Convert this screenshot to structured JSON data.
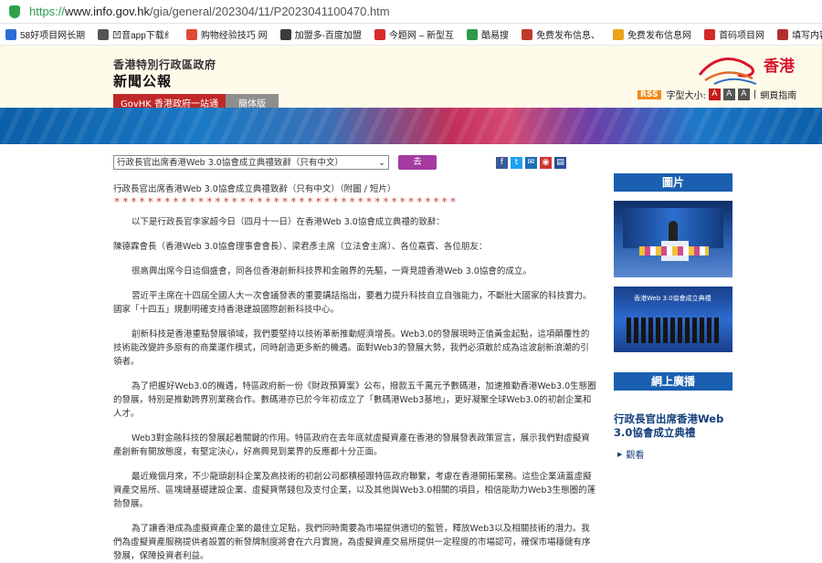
{
  "browser": {
    "url_https": "https://",
    "url_host": "www.info.gov.hk",
    "url_path": "/gia/general/202304/11/P2023041100470.htm",
    "bookmarks": [
      {
        "label": "58好项目网长期",
        "color": "#2d6dd6"
      },
      {
        "label": "凹音app下载纟",
        "color": "#555555"
      },
      {
        "label": "购物经验技巧 网",
        "color": "#e0493a"
      },
      {
        "label": "加盟多-百度加盟",
        "color": "#3b3b3b"
      },
      {
        "label": "今题网 – 新型互",
        "color": "#d82a2a"
      },
      {
        "label": "酷易搜",
        "color": "#2c9a4c"
      },
      {
        "label": "免费发布信息、",
        "color": "#c0392b"
      },
      {
        "label": "免费发布信息网",
        "color": "#e8a319"
      },
      {
        "label": "首码项目网",
        "color": "#d02a2a"
      },
      {
        "label": "填写内容-登录",
        "color": "#b03030"
      }
    ]
  },
  "header": {
    "govt_name": "香港特別行政區政府",
    "site_title": "新聞公報",
    "logo_text": "香港",
    "rss": "RSS",
    "font_size_label": "字型大小:",
    "font_sizes": [
      "A",
      "A",
      "A"
    ],
    "guide": "網頁指南",
    "nav_govhk": "GovHK 香港政府一站通",
    "nav_simplified": "簡体版"
  },
  "article": {
    "select_value": "行政長官出席香港Web 3.0協會成立典禮致辭（只有中文）",
    "go_button": "去",
    "headline": "行政長官出席香港Web 3.0協會成立典禮致辭（只有中文）（附圖 / 短片）",
    "stars": "＊＊＊＊＊＊＊＊＊＊＊＊＊＊＊＊＊＊＊＊＊＊＊＊＊＊＊＊＊＊＊＊＊＊＊＊＊＊＊＊＊",
    "paragraphs": [
      "以下是行政長官李家超今日（四月十一日）在香港Web 3.0協會成立典禮的致辭：",
      "陳德霖會長（香港Web 3.0協會理事會會長）、梁君彥主席（立法會主席）、各位嘉賓、各位朋友：",
      "很高興出席今日這個盛會，同各位香港創新科技界和金融界的先驅，一齊見證香港Web 3.0協會的成立。",
      "習近平主席在十四屆全國人大一次會議發表的重要講話指出，要着力提升科技自立自強能力，不斷壯大國家的科技實力。國家「十四五」規劃明確支持香港建設國際創新科技中心。",
      "創新科技是香港重點發展領域，我們要堅持以技術革新推動經濟增長。Web3.0的發展現時正值黃金起點，這項顛覆性的技術能改變許多原有的商業運作模式，同時創造更多新的機遇。面對Web3的發展大勢，我們必須敢於成為這波創新浪潮的引領者。",
      "為了把握好Web3.0的機遇，特區政府新一份《財政預算案》公布，撥款五千萬元予數碼港，加速推動香港Web3.0生態圈的發展，特別是推動跨界別業務合作。數碼港亦已於今年初成立了「數碼港Web3基地」，更好凝聚全球Web3.0的初創企業和人才。",
      "Web3對金融科技的發展起着關鍵的作用。特區政府在去年底就虛擬資產在香港的發展發表政策宣言，展示我們對虛擬資產創新有開放態度，有堅定決心，好高興見到業界的反應都十分正面。",
      "最近幾個月來，不少龍頭創科企業及高技術的初創公司都積極跟特區政府聯繫，考慮在香港開拓業務。這些企業涵蓋虛擬資產交易所、區塊鏈基礎建設企業、虛擬貨幣錢包及支付企業，以及其他與Web3.0相關的項目，相信能助力Web3生態圈的蓬勃發展。",
      "為了讓香港成為虛擬資產企業的最佳立足點，我們同時需要為市場提供適切的監管，釋放Web3以及相關技術的潛力。我們為虛擬資產服務提供者設置的新發牌制度將會在六月實施，為虛擬資產交易所提供一定程度的市場認可，確保市場穩健有序發展，保障投資者利益。"
    ]
  },
  "sidebar": {
    "photos_heading": "圖片",
    "photo2_caption": "香港Web 3.0協會成立典禮",
    "webcast_heading": "網上廣播",
    "webcast_title": "行政長官出席香港Web 3.0協會成立典禮",
    "watch_label": "觀看"
  },
  "colors": {
    "brand_red": "#c02828",
    "sidebar_blue": "#1a5fb0",
    "go_purple": "#a53aa0",
    "header_bg": "#fffbea"
  }
}
